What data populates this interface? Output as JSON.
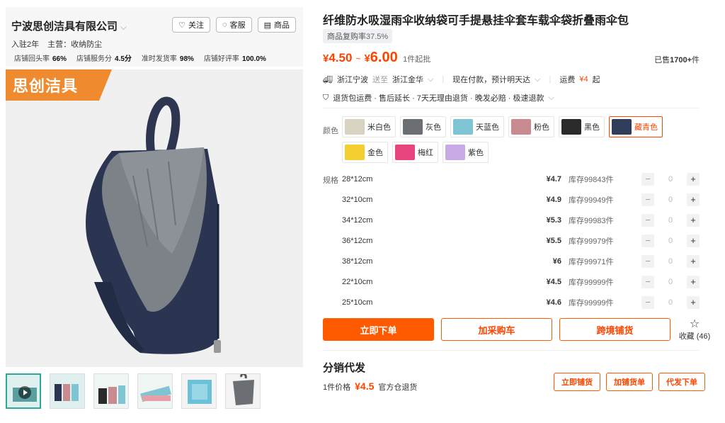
{
  "shop": {
    "name": "宁波思创洁具有限公司",
    "follow_label": "关注",
    "service_label": "客服",
    "goods_label": "商品",
    "meta_years": "入驻2年",
    "meta_main": "主营：收纳防尘",
    "stats": [
      {
        "label": "店铺回头率",
        "value": "66%"
      },
      {
        "label": "店铺服务分",
        "value": "4.5分"
      },
      {
        "label": "准时发货率",
        "value": "98%"
      },
      {
        "label": "店铺好评率",
        "value": "100.0%"
      }
    ]
  },
  "image": {
    "brand_tag": "思创洁具"
  },
  "product": {
    "title": "纤维防水吸湿雨伞收纳袋可手提悬挂伞套车载伞袋折叠雨伞包",
    "repurchase_label": "商品复购率",
    "repurchase_value": "37.5%",
    "price_symbol": "¥",
    "price_low": "4.50",
    "price_high": "6.00",
    "price_sep": "~",
    "moq": "1件起批",
    "sold_prefix": "已售",
    "sold_value": "1700+",
    "sold_suffix": "件"
  },
  "shipping": {
    "from": "浙江宁波",
    "to_word": "送至",
    "to": "浙江金华",
    "delivery": "现在付款，预计明天达",
    "freight_label": "运费",
    "freight_value": "¥4",
    "freight_suffix": "起"
  },
  "services": "退货包运费 · 售后延长 · 7天无理由退货 · 晚发必赔 · 极速退款",
  "colors_label": "颜色",
  "colors": [
    {
      "name": "米白色",
      "swatch": "#d8d2c0",
      "hot": true
    },
    {
      "name": "灰色",
      "swatch": "#6b6e73",
      "hot": true
    },
    {
      "name": "天蓝色",
      "swatch": "#7fc4d2",
      "hot": true
    },
    {
      "name": "粉色",
      "swatch": "#c98b8f",
      "hot": true
    },
    {
      "name": "黑色",
      "swatch": "#2a2a2a",
      "hot": false
    },
    {
      "name": "藏青色",
      "swatch": "#2f3c5a",
      "hot": true,
      "selected": true
    },
    {
      "name": "金色",
      "swatch": "#f2cf2f",
      "hot": false
    },
    {
      "name": "梅红",
      "swatch": "#e8447f",
      "hot": false
    },
    {
      "name": "紫色",
      "swatch": "#c9a9e6",
      "hot": false
    }
  ],
  "sizes_label": "规格",
  "sizes": [
    {
      "name": "28*12cm",
      "price": "¥4.7",
      "stock": "库存99843件",
      "qty": "0"
    },
    {
      "name": "32*10cm",
      "price": "¥4.9",
      "stock": "库存99949件",
      "qty": "0"
    },
    {
      "name": "34*12cm",
      "price": "¥5.3",
      "stock": "库存99983件",
      "qty": "0"
    },
    {
      "name": "36*12cm",
      "price": "¥5.5",
      "stock": "库存99979件",
      "qty": "0"
    },
    {
      "name": "38*12cm",
      "price": "¥6",
      "stock": "库存99971件",
      "qty": "0"
    },
    {
      "name": "22*10cm",
      "price": "¥4.5",
      "stock": "库存99999件",
      "qty": "0"
    },
    {
      "name": "25*10cm",
      "price": "¥4.6",
      "stock": "库存99999件",
      "qty": "0"
    }
  ],
  "actions": {
    "buy_now": "立即下单",
    "add_cart": "加采购车",
    "cross_border": "跨境铺货",
    "favorite_label": "收藏",
    "favorite_count": "(46)"
  },
  "distribution": {
    "title": "分销代发",
    "price_label": "1件价格",
    "price": "¥4.5",
    "return_note": "官方仓退货",
    "btn_list": "立即铺货",
    "btn_add": "加铺货单",
    "btn_order": "代发下单"
  },
  "colors_theme": {
    "accent": "#ff4400",
    "button": "#ff5a00",
    "brand_tag": "#f08a2e"
  }
}
